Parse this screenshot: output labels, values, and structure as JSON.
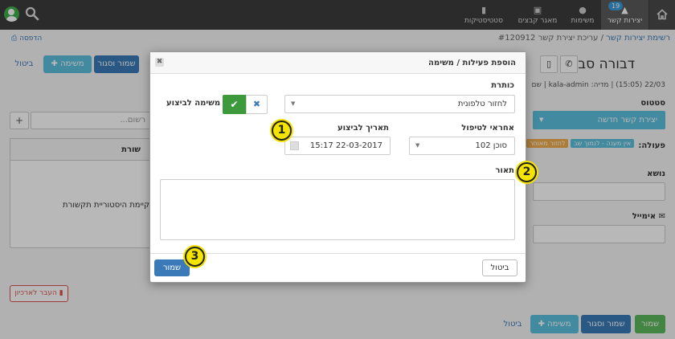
{
  "nav": {
    "crm": "יצירות קשר",
    "crm_badge": "19",
    "tasks": "משימות",
    "files": "מאגר קבצים",
    "stats": "סטטיסטיקות"
  },
  "breadcrumb": {
    "root": "רשימת יצירות קשר",
    "separator": "/",
    "current": "עריכת יצירת קשר #120912"
  },
  "print_label": "הדפסה",
  "page": {
    "contact_name": "דבורה סבג",
    "meta": "22/03 (15:05) | מדיה: kala-admin | שם",
    "status_label": "סטטוס",
    "status_value": "יצירת קשר חדשה",
    "action_label": "פעולה:",
    "action_chip_1": "אין מענה - לנמוך שב",
    "action_chip_2": "לחזור מאוחר",
    "subject_label": "נושא",
    "email_label": "אימייל",
    "history_text": "קיימת היסטוריית תקשורת",
    "history_head": "שורת",
    "search_placeholder": "רשום...",
    "archive": "העבר לארכיון"
  },
  "buttons": {
    "save": "שמור",
    "save_close": "שמור וסגור",
    "task": "משימה",
    "cancel": "ביטול"
  },
  "modal": {
    "title": "הוספת פעילות / משימה",
    "subject_label": "כותרת",
    "subject_value": "לחזור טלפונית",
    "task_toggle_label": "משימה לביצוע",
    "assignee_label": "אחראי לטיפול",
    "assignee_value": "סוכן 102",
    "due_label": "תאריך לביצוע",
    "due_value": "22-03-2017 15:17",
    "description_label": "תאור",
    "save": "שמור",
    "cancel": "ביטול"
  },
  "markers": [
    "1",
    "2",
    "3"
  ],
  "colors": {
    "topbar": "#3c3c3c",
    "primary": "#3a7ab8",
    "success": "#3c9a3c",
    "marker": "#f5e300"
  }
}
